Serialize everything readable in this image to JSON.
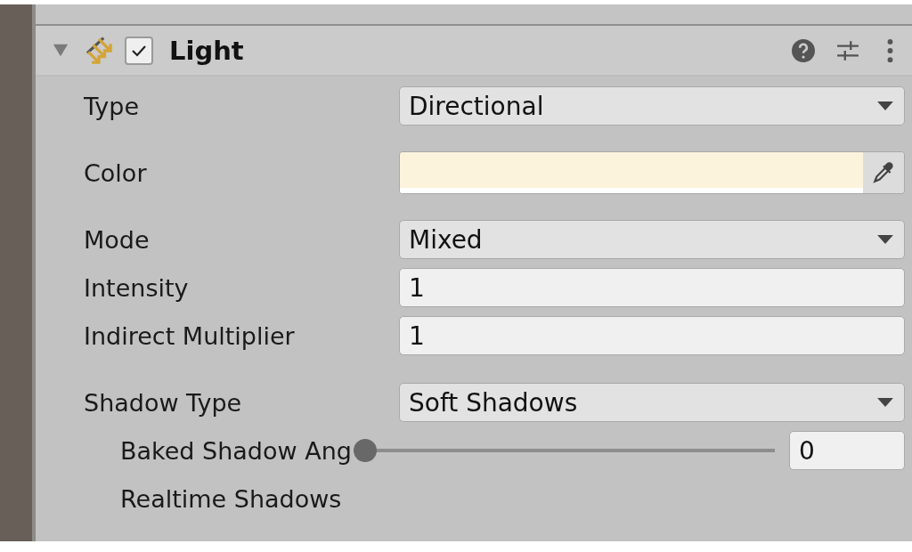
{
  "component": {
    "title": "Light",
    "expanded": true,
    "enabled": true
  },
  "sections": [
    [
      {
        "kind": "dropdown",
        "label": "Type",
        "value": "Directional"
      }
    ],
    [
      {
        "kind": "color",
        "label": "Color",
        "color": "#fbf3dc"
      }
    ],
    [
      {
        "kind": "dropdown",
        "label": "Mode",
        "value": "Mixed"
      },
      {
        "kind": "number",
        "label": "Intensity",
        "value": "1"
      },
      {
        "kind": "number",
        "label": "Indirect Multiplier",
        "value": "1"
      }
    ],
    [
      {
        "kind": "dropdown",
        "label": "Shadow Type",
        "value": "Soft Shadows",
        "children": [
          {
            "kind": "slider",
            "label": "Baked Shadow Ang",
            "level": 0,
            "value": "0"
          },
          {
            "kind": "label",
            "label": "Realtime Shadows"
          }
        ]
      }
    ]
  ]
}
